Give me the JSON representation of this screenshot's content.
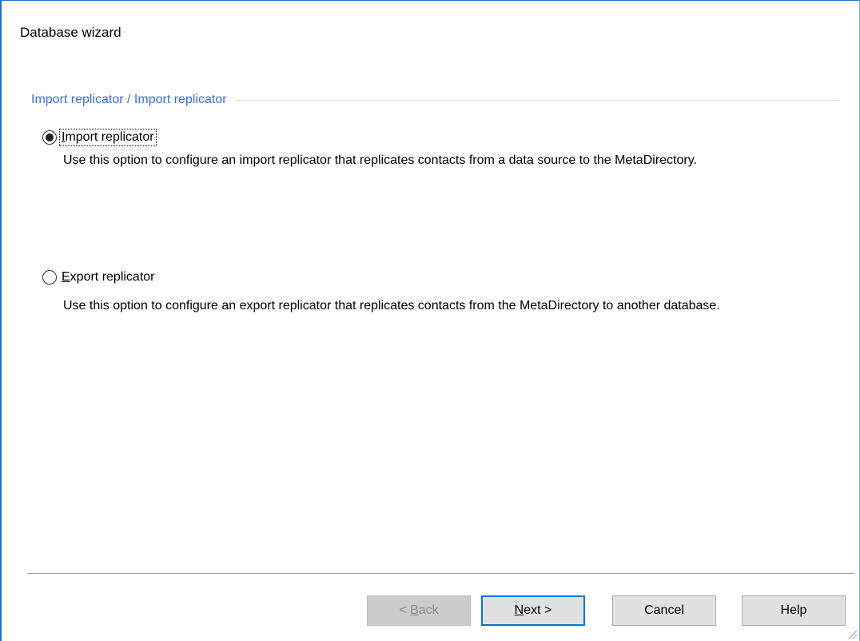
{
  "window": {
    "title": "Database wizard"
  },
  "group": {
    "title": "Import replicator / Import replicator"
  },
  "options": [
    {
      "label_prefix": "",
      "label_mnemonic": "I",
      "label_rest": "mport replicator",
      "selected": true,
      "description": "Use this option to configure an import replicator that replicates contacts from a data source to the MetaDirectory."
    },
    {
      "label_prefix": "",
      "label_mnemonic": "E",
      "label_rest": "xport replicator",
      "selected": false,
      "description": "Use this option to configure an export replicator that replicates contacts from the MetaDirectory to another database."
    }
  ],
  "buttons": {
    "back_prefix": "< ",
    "back_mnemonic": "B",
    "back_rest": "ack",
    "next_mnemonic": "N",
    "next_rest": "ext >",
    "cancel": "Cancel",
    "help": "Help"
  },
  "colors": {
    "group_title": "#3c6fd4",
    "window_border": "#1f6fc7",
    "default_button_border": "#0078d7"
  }
}
